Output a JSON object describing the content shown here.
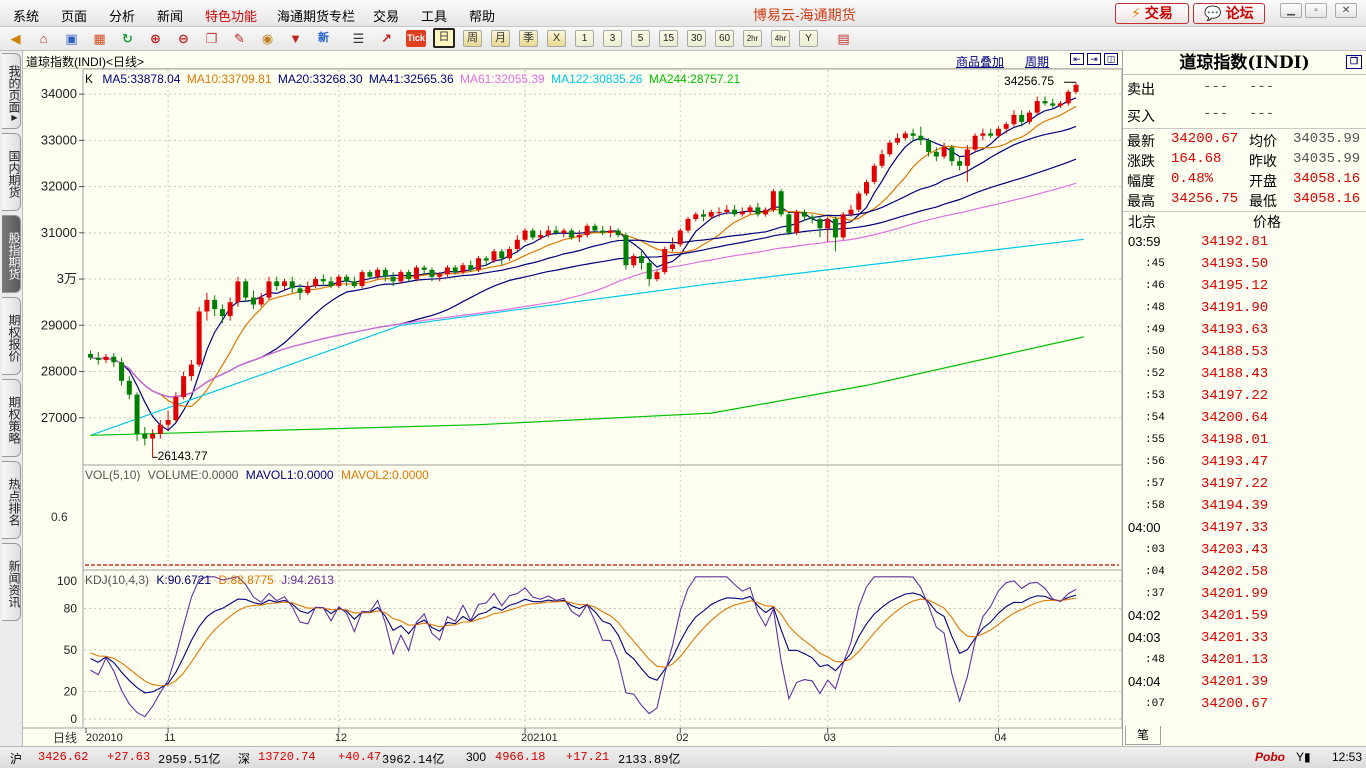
{
  "app_title": "博易云-海通期货",
  "menu": [
    "系统",
    "页面",
    "分析",
    "新闻",
    "特色功能",
    "海通期货专栏",
    "交易",
    "工具",
    "帮助"
  ],
  "top_buttons": {
    "trade": "交易",
    "forum": "论坛"
  },
  "toolbar": {
    "icons": [
      "back-icon",
      "home-icon",
      "save-icon",
      "calendar-icon",
      "refresh-icon",
      "zoom-in-icon",
      "zoom-out-icon",
      "window-icon",
      "pencil-icon",
      "palette-icon",
      "filter-icon",
      "news-icon"
    ],
    "tick_label": "Tick",
    "new_label": "新",
    "periods_text": [
      "日",
      "周",
      "月",
      "季",
      "X"
    ],
    "periods_num": [
      "1",
      "3",
      "5",
      "15",
      "30",
      "60",
      "2hr",
      "4hr",
      "Y"
    ]
  },
  "sidebar_tabs": [
    "我的页面",
    "国内期货",
    "股指期货",
    "期权报价",
    "期权策略",
    "热点排名",
    "新闻资讯"
  ],
  "chart": {
    "title": "道琼指数(INDI)<日线>",
    "link_overlay": "商品叠加",
    "link_period": "周期",
    "ma_prefix": "K",
    "ma": [
      {
        "label": "MA5:33878.04",
        "color": "#000080"
      },
      {
        "label": "MA10:33709.81",
        "color": "#e07800"
      },
      {
        "label": "MA20:33268.30",
        "color": "#000080"
      },
      {
        "label": "MA41:32565.36",
        "color": "#000080"
      },
      {
        "label": "MA61:32055.39",
        "color": "#e070e0"
      },
      {
        "label": "MA122:30835.26",
        "color": "#00c8e8"
      },
      {
        "label": "MA244:28757.21",
        "color": "#00c000"
      }
    ],
    "high_label": "34256.75",
    "low_label": "26143.77",
    "vol_label": "VOL(5,10)",
    "vol_value": "VOLUME:0.0000",
    "mavol1": "MAVOL1:0.0000",
    "mavol2": "MAVOL2:0.0000",
    "vol_tick": "0.6",
    "kdj_label": "KDJ(10,4,3)",
    "kdj_k": "K:90.6721",
    "kdj_d": "D:88.8775",
    "kdj_j": "J:94.2613",
    "period_tag": "日线"
  },
  "chart_data": {
    "type": "candlestick",
    "price_axis": {
      "ticks": [
        27000,
        28000,
        29000,
        30000,
        31000,
        32000,
        33000,
        34000
      ],
      "tick_labels": [
        "27000",
        "28000",
        "29000",
        "3万",
        "31000",
        "32000",
        "33000",
        "34000"
      ],
      "ylim": [
        26000,
        34500
      ]
    },
    "kdj_axis": {
      "ticks": [
        0,
        20,
        50,
        80,
        100
      ],
      "ylim": [
        -5,
        105
      ]
    },
    "x_labels": [
      "202010",
      "11",
      "12",
      "202101",
      "02",
      "03",
      "04"
    ],
    "x_label_index": [
      0,
      10,
      32,
      56,
      76,
      95,
      117
    ],
    "candles": [
      [
        28380,
        28300,
        28450,
        28250
      ],
      [
        28300,
        28250,
        28420,
        28150
      ],
      [
        28250,
        28320,
        28380,
        28180
      ],
      [
        28320,
        28200,
        28400,
        28100
      ],
      [
        28200,
        27800,
        28300,
        27700
      ],
      [
        27800,
        27500,
        27900,
        27400
      ],
      [
        27500,
        26650,
        27550,
        26500
      ],
      [
        26650,
        26550,
        26800,
        26400
      ],
      [
        26550,
        26650,
        26750,
        26140
      ],
      [
        26650,
        26850,
        26950,
        26550
      ],
      [
        26850,
        26950,
        27150,
        26750
      ],
      [
        26950,
        27450,
        27550,
        26900
      ],
      [
        27450,
        27900,
        28000,
        27400
      ],
      [
        27900,
        28150,
        28250,
        27800
      ],
      [
        28150,
        29300,
        29400,
        28100
      ],
      [
        29300,
        29550,
        29700,
        29100
      ],
      [
        29550,
        29350,
        29650,
        29200
      ],
      [
        29350,
        29200,
        29450,
        29050
      ],
      [
        29200,
        29500,
        29600,
        29100
      ],
      [
        29500,
        29950,
        30050,
        29400
      ],
      [
        29950,
        29600,
        30000,
        29500
      ],
      [
        29600,
        29450,
        29750,
        29350
      ],
      [
        29450,
        29600,
        29700,
        29400
      ],
      [
        29600,
        29950,
        30050,
        29550
      ],
      [
        29950,
        29850,
        30050,
        29750
      ],
      [
        29850,
        29950,
        30000,
        29750
      ],
      [
        29950,
        29800,
        30050,
        29700
      ],
      [
        29800,
        29700,
        29900,
        29550
      ],
      [
        29700,
        29850,
        29950,
        29650
      ],
      [
        29850,
        30000,
        30050,
        29800
      ],
      [
        30000,
        29950,
        30100,
        29850
      ],
      [
        29950,
        29850,
        30050,
        29800
      ],
      [
        29850,
        30050,
        30100,
        29800
      ],
      [
        30050,
        29950,
        30100,
        29850
      ],
      [
        29950,
        29850,
        30050,
        29800
      ],
      [
        29850,
        30150,
        30200,
        29800
      ],
      [
        30150,
        30050,
        30200,
        30000
      ],
      [
        30050,
        30200,
        30250,
        30000
      ],
      [
        30200,
        30050,
        30250,
        29950
      ],
      [
        30050,
        29950,
        30150,
        29850
      ],
      [
        29950,
        30150,
        30200,
        29900
      ],
      [
        30150,
        30000,
        30200,
        29950
      ],
      [
        30000,
        30250,
        30300,
        29950
      ],
      [
        30250,
        30200,
        30300,
        30100
      ],
      [
        30200,
        30050,
        30250,
        29950
      ],
      [
        30050,
        30100,
        30150,
        29950
      ],
      [
        30100,
        30250,
        30300,
        30050
      ],
      [
        30250,
        30150,
        30300,
        30100
      ],
      [
        30150,
        30300,
        30350,
        30100
      ],
      [
        30300,
        30200,
        30400,
        30150
      ],
      [
        30200,
        30450,
        30500,
        30150
      ],
      [
        30450,
        30400,
        30500,
        30300
      ],
      [
        30400,
        30600,
        30650,
        30350
      ],
      [
        30600,
        30450,
        30650,
        30300
      ],
      [
        30450,
        30650,
        30700,
        30400
      ],
      [
        30650,
        30850,
        30950,
        30600
      ],
      [
        30850,
        31050,
        31100,
        30800
      ],
      [
        31050,
        30900,
        31100,
        30850
      ],
      [
        30900,
        30950,
        31050,
        30850
      ],
      [
        30950,
        31050,
        31150,
        30900
      ],
      [
        31050,
        31000,
        31150,
        30950
      ],
      [
        31000,
        31050,
        31100,
        30900
      ],
      [
        31050,
        30900,
        31100,
        30850
      ],
      [
        30900,
        30950,
        31050,
        30800
      ],
      [
        30950,
        31150,
        31200,
        30900
      ],
      [
        31150,
        31050,
        31200,
        31000
      ],
      [
        31050,
        31000,
        31150,
        30950
      ],
      [
        31000,
        31050,
        31150,
        30900
      ],
      [
        31050,
        30950,
        31100,
        30900
      ],
      [
        30950,
        30300,
        31000,
        30200
      ],
      [
        30300,
        30500,
        30550,
        30250
      ],
      [
        30500,
        30350,
        30600,
        30200
      ],
      [
        30350,
        30000,
        30400,
        29850
      ],
      [
        30000,
        30150,
        30200,
        29950
      ],
      [
        30150,
        30650,
        30700,
        30100
      ],
      [
        30650,
        30750,
        30900,
        30600
      ],
      [
        30750,
        31050,
        31100,
        30700
      ],
      [
        31050,
        31300,
        31350,
        31000
      ],
      [
        31300,
        31400,
        31450,
        31250
      ],
      [
        31400,
        31350,
        31500,
        31250
      ],
      [
        31350,
        31450,
        31500,
        31300
      ],
      [
        31450,
        31450,
        31550,
        31350
      ],
      [
        31450,
        31500,
        31600,
        31400
      ],
      [
        31500,
        31400,
        31600,
        31350
      ],
      [
        31400,
        31450,
        31550,
        31350
      ],
      [
        31450,
        31550,
        31600,
        31400
      ],
      [
        31550,
        31400,
        31650,
        31350
      ],
      [
        31400,
        31500,
        31550,
        31350
      ],
      [
        31500,
        31900,
        31950,
        31450
      ],
      [
        31900,
        31400,
        31950,
        31350
      ],
      [
        31400,
        31000,
        31450,
        30950
      ],
      [
        31000,
        31450,
        31500,
        30950
      ],
      [
        31450,
        31350,
        31500,
        31250
      ],
      [
        31350,
        31300,
        31400,
        31200
      ],
      [
        31300,
        31100,
        31350,
        30900
      ],
      [
        31100,
        31300,
        31350,
        30800
      ],
      [
        31300,
        30900,
        31350,
        30600
      ],
      [
        30900,
        31400,
        31450,
        30850
      ],
      [
        31400,
        31500,
        31600,
        31350
      ],
      [
        31500,
        31850,
        31900,
        31450
      ],
      [
        31850,
        32100,
        32150,
        31800
      ],
      [
        32100,
        32450,
        32500,
        32050
      ],
      [
        32450,
        32700,
        32800,
        32400
      ],
      [
        32700,
        32950,
        33000,
        32650
      ],
      [
        32950,
        33050,
        33150,
        32900
      ],
      [
        33050,
        33150,
        33200,
        33000
      ],
      [
        33150,
        33100,
        33250,
        33000
      ],
      [
        33100,
        33000,
        33300,
        32900
      ],
      [
        33000,
        32750,
        33050,
        32650
      ],
      [
        32750,
        32650,
        32850,
        32550
      ],
      [
        32650,
        32850,
        32950,
        32600
      ],
      [
        32850,
        32550,
        32900,
        32450
      ],
      [
        32550,
        32450,
        32650,
        32350
      ],
      [
        32450,
        32800,
        32900,
        32100
      ],
      [
        32800,
        33100,
        33150,
        32750
      ],
      [
        33100,
        33150,
        33250,
        33000
      ],
      [
        33150,
        33100,
        33250,
        33050
      ],
      [
        33100,
        33250,
        33300,
        33050
      ],
      [
        33250,
        33350,
        33400,
        33150
      ],
      [
        33350,
        33550,
        33650,
        33300
      ],
      [
        33550,
        33400,
        33650,
        33300
      ],
      [
        33400,
        33600,
        33650,
        33350
      ],
      [
        33600,
        33850,
        33950,
        33550
      ],
      [
        33850,
        33800,
        33950,
        33750
      ],
      [
        33800,
        33750,
        33900,
        33700
      ],
      [
        33750,
        33800,
        33850,
        33700
      ],
      [
        33800,
        34050,
        34100,
        33750
      ],
      [
        34050,
        34200,
        34256.75,
        34000
      ]
    ],
    "ma_series": [
      {
        "name": "MA5",
        "color": "#000080"
      },
      {
        "name": "MA10",
        "color": "#e07800"
      },
      {
        "name": "MA20",
        "color": "#000080"
      },
      {
        "name": "MA41",
        "color": "#000080"
      },
      {
        "name": "MA61",
        "color": "#e070e0"
      },
      {
        "name": "MA122",
        "color": "#00c8e8",
        "points": [
          [
            0,
            26620
          ],
          [
            40,
            29000
          ],
          [
            80,
            29900
          ],
          [
            128,
            30860
          ]
        ]
      },
      {
        "name": "MA244",
        "color": "#00c000",
        "points": [
          [
            0,
            26620
          ],
          [
            50,
            26850
          ],
          [
            80,
            27100
          ],
          [
            100,
            27700
          ],
          [
            128,
            28750
          ]
        ]
      }
    ],
    "kdj_series": [
      {
        "name": "K",
        "color": "#000080"
      },
      {
        "name": "D",
        "color": "#e07800"
      },
      {
        "name": "J",
        "color": "#6030a0"
      }
    ]
  },
  "quote": {
    "title": "道琼指数(INDI)",
    "sell_label": "卖出",
    "sell_values": [
      "---",
      "---"
    ],
    "buy_label": "买入",
    "buy_values": [
      "---",
      "---"
    ],
    "rows": [
      {
        "l1": "最新",
        "v1": "34200.67",
        "l2": "均价",
        "v2": "34035.99"
      },
      {
        "l1": "涨跌",
        "v1": "164.68",
        "l2": "昨收",
        "v2": "34035.99"
      },
      {
        "l1": "幅度",
        "v1": "0.48%",
        "l2": "开盘",
        "v2": "34058.16"
      },
      {
        "l1": "最高",
        "v1": "34256.75",
        "l2": "最低",
        "v2": "34058.16"
      }
    ],
    "tick_header": {
      "place": "北京",
      "price": "价格"
    },
    "ticks": [
      {
        "t": "03:59",
        "p": "34192.81"
      },
      {
        "t": ":45",
        "p": "34193.50"
      },
      {
        "t": ":46",
        "p": "34195.12"
      },
      {
        "t": ":48",
        "p": "34191.90"
      },
      {
        "t": ":49",
        "p": "34193.63"
      },
      {
        "t": ":50",
        "p": "34188.53"
      },
      {
        "t": ":52",
        "p": "34188.43"
      },
      {
        "t": ":53",
        "p": "34197.22"
      },
      {
        "t": ":54",
        "p": "34200.64"
      },
      {
        "t": ":55",
        "p": "34198.01"
      },
      {
        "t": ":56",
        "p": "34193.47"
      },
      {
        "t": ":57",
        "p": "34197.22"
      },
      {
        "t": ":58",
        "p": "34194.39"
      },
      {
        "t": "04:00",
        "p": "34197.33"
      },
      {
        "t": ":03",
        "p": "34203.43"
      },
      {
        "t": ":04",
        "p": "34202.58"
      },
      {
        "t": ":37",
        "p": "34201.99"
      },
      {
        "t": "04:02",
        "p": "34201.59"
      },
      {
        "t": "04:03",
        "p": "34201.33"
      },
      {
        "t": ":48",
        "p": "34201.13"
      },
      {
        "t": "04:04",
        "p": "34201.39"
      },
      {
        "t": ":07",
        "p": "34200.67"
      }
    ],
    "bottom_tab": "笔"
  },
  "status": {
    "sh_label": "沪",
    "sh_price": "3426.62",
    "sh_chg": "+27.63",
    "sh_amt": "2959.51亿",
    "sz_label": "深",
    "sz_price": "13720.74",
    "sz_chg": "+40.47",
    "sz_amt": "3962.14亿",
    "i300_label": "300",
    "i300_price": "4966.18",
    "i300_chg": "+17.21",
    "i300_amt": "2133.89亿",
    "brand": "Pobo",
    "clock": "12:53"
  }
}
